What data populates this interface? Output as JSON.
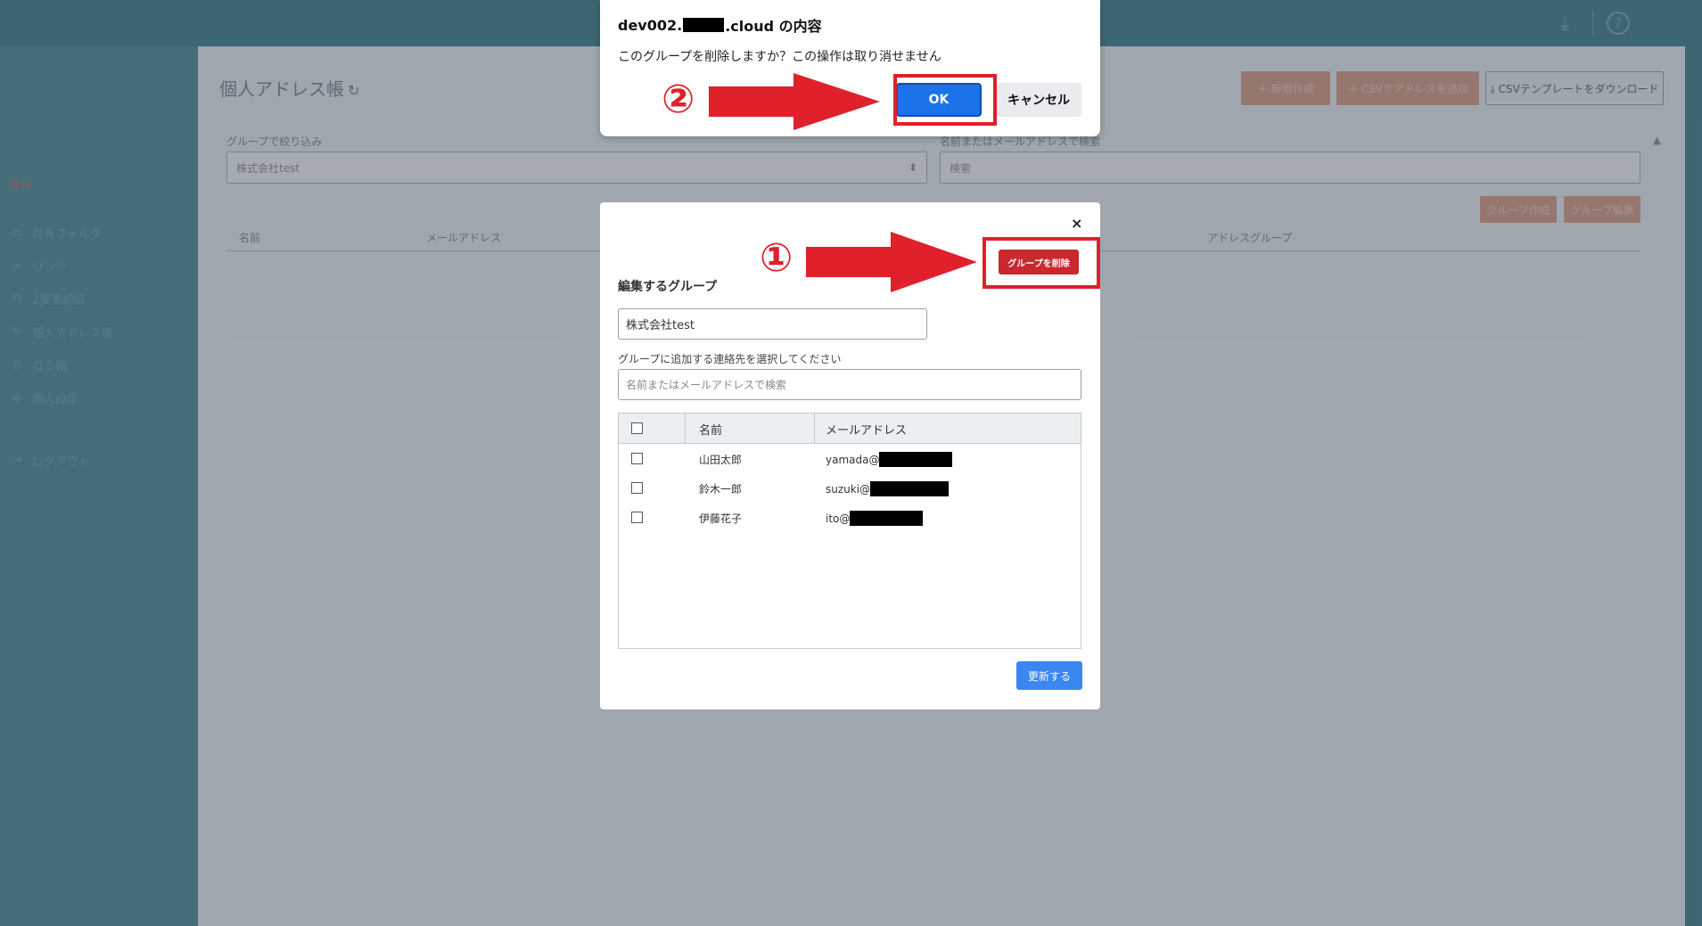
{
  "topbar": {
    "download_icon": "download-icon",
    "help_label": "?"
  },
  "sidebar": {
    "section_label": "操作",
    "items": [
      {
        "icon": "folder-icon",
        "glyph": "▭",
        "label": "共有フォルダ"
      },
      {
        "icon": "link-icon",
        "glyph": "∞",
        "label": "リンク"
      },
      {
        "icon": "lock-icon",
        "glyph": "⊓",
        "label": "2要素認証"
      },
      {
        "icon": "address-book-icon",
        "glyph": "✎",
        "label": "個人アドレス帳"
      },
      {
        "icon": "trash-icon",
        "glyph": "▯",
        "label": "ゴミ箱"
      },
      {
        "icon": "gear-icon",
        "glyph": "⚙",
        "label": "個人設定"
      },
      {
        "icon": "logout-icon",
        "glyph": "⇥",
        "label": "ログアウト"
      }
    ]
  },
  "main": {
    "title": "個人アドレス帳",
    "refresh_glyph": "↻",
    "buttons": {
      "new": "＋ 新規作成",
      "csv_add": "＋ CSVでアドレスを追加",
      "csv_template": "⤓ CSVテンプレートをダウンロード",
      "group_create": "グループ作成",
      "group_edit": "グループ編集"
    },
    "filter": {
      "group_label": "グループで絞り込み",
      "group_value": "株式会社test",
      "select_arrows": "⬍",
      "search_label": "名前またはメールアドレスで検索",
      "search_placeholder": "検索",
      "up_caret": "▲"
    },
    "columns": [
      "名前",
      "メールアドレス",
      "アドレスグループ"
    ]
  },
  "modal": {
    "close": "×",
    "delete_button": "グループを削除",
    "edit_group_label": "編集するグループ",
    "group_name": "株式会社test",
    "add_contacts_label": "グループに追加する連絡先を選択してください",
    "search_placeholder": "名前またはメールアドレスで検索",
    "table": {
      "headers": {
        "name": "名前",
        "email": "メールアドレス"
      },
      "rows": [
        {
          "name": "山田太郎",
          "email": "yamada@"
        },
        {
          "name": "鈴木一郎",
          "email": "suzuki@"
        },
        {
          "name": "伊藤花子",
          "email": "ito@"
        }
      ]
    },
    "update_button": "更新する"
  },
  "confirm": {
    "title_prefix": "dev002.",
    "title_suffix": ".cloud の内容",
    "message": "このグループを削除しますか？この操作は取り消せません",
    "ok": "OK",
    "cancel": "キャンセル"
  },
  "annotations": {
    "step1": "①",
    "step2": "②",
    "color": "#e0202a"
  }
}
